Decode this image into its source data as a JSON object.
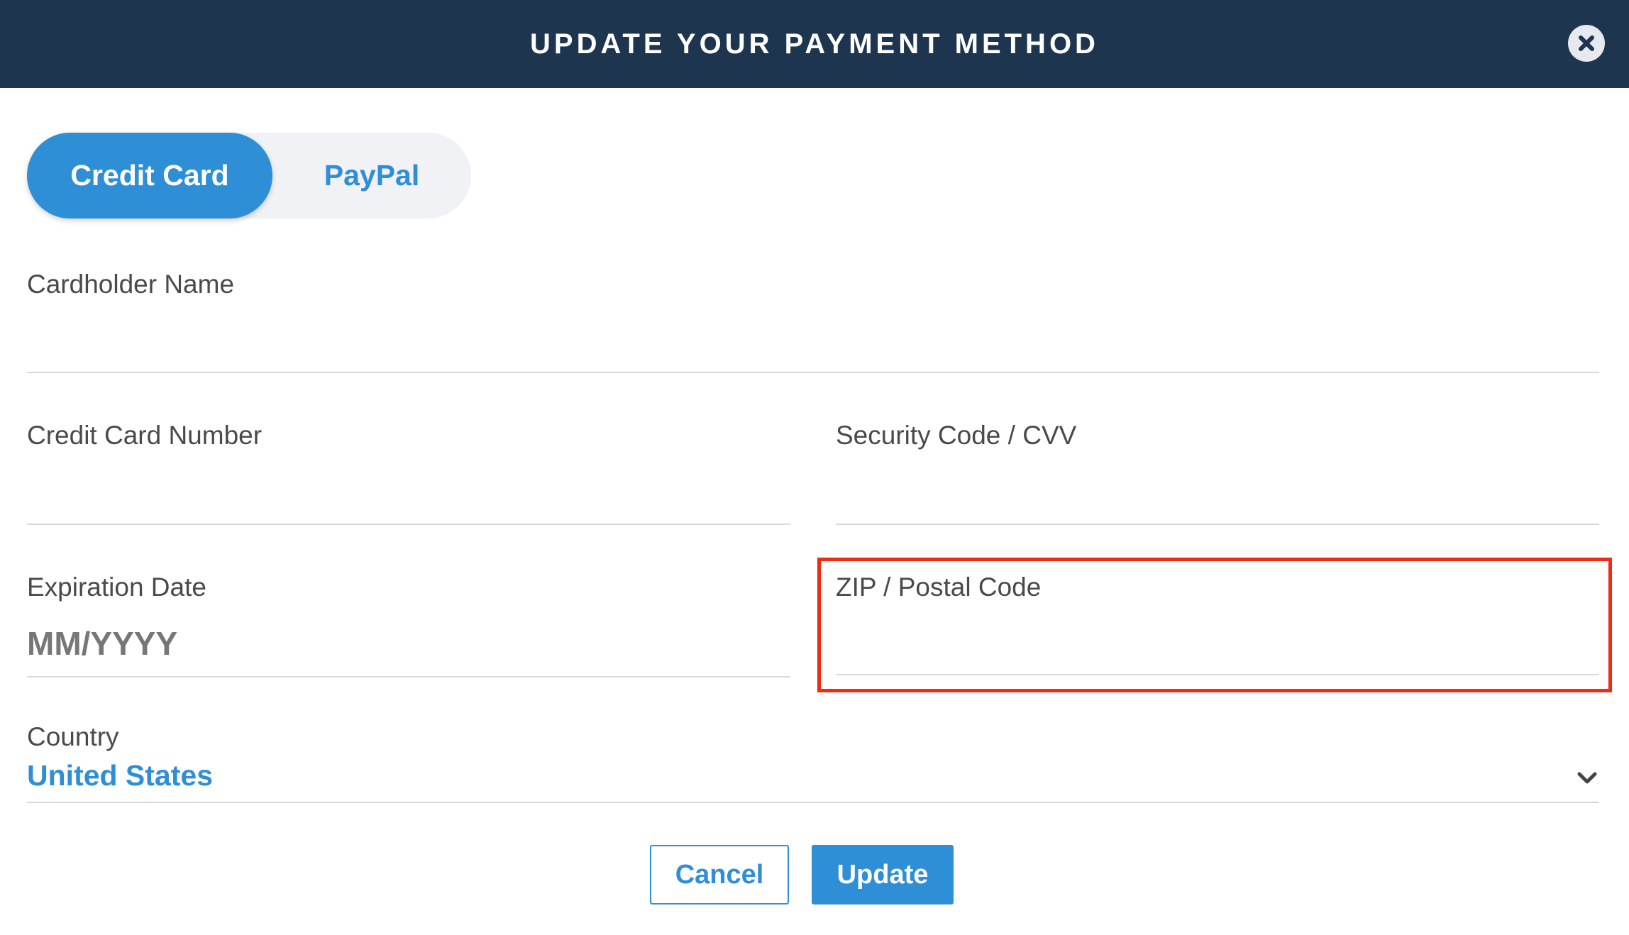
{
  "header": {
    "title": "UPDATE YOUR PAYMENT METHOD",
    "close_icon": "close-icon"
  },
  "payment_toggle": {
    "options": [
      {
        "label": "Credit Card",
        "selected": true
      },
      {
        "label": "PayPal",
        "selected": false
      }
    ]
  },
  "form": {
    "cardholder_name": {
      "label": "Cardholder Name",
      "value": "",
      "placeholder": ""
    },
    "card_number": {
      "label": "Credit Card Number",
      "value": "",
      "placeholder": ""
    },
    "security_code": {
      "label": "Security Code / CVV",
      "value": "",
      "placeholder": ""
    },
    "expiration_date": {
      "label": "Expiration Date",
      "value": "",
      "placeholder": "MM/YYYY"
    },
    "zip_code": {
      "label": "ZIP / Postal Code",
      "value": "",
      "placeholder": ""
    },
    "country": {
      "label": "Country",
      "value": "United States",
      "icon": "chevron-down-icon"
    }
  },
  "actions": {
    "cancel_label": "Cancel",
    "update_label": "Update"
  },
  "colors": {
    "header_bg": "#1e3550",
    "accent": "#2f8fd6",
    "highlight": "#f02a13"
  }
}
